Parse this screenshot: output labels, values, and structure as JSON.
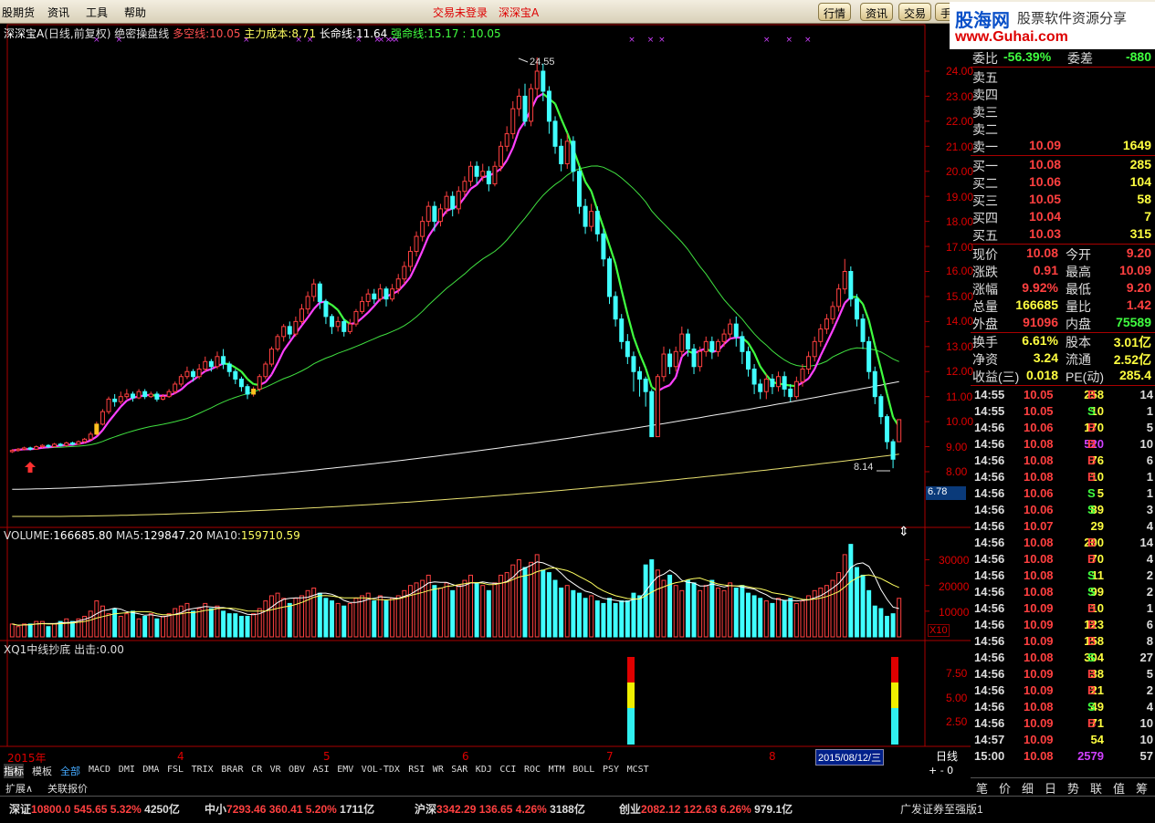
{
  "menu": [
    "股期货",
    "资讯",
    "工具",
    "帮助"
  ],
  "title_center": [
    "交易未登录",
    "深深宝A"
  ],
  "toolbar_buttons": [
    "行情",
    "资讯",
    "交易",
    "手"
  ],
  "watermark": {
    "brand": "股海网",
    "tagline": "股票软件资源分享",
    "url": "www.Guhai.com"
  },
  "info_line": {
    "stock": "深深宝A",
    "mode": "(日线,前复权)",
    "indicator": "绝密操盘线",
    "duokong_label": "多空线:",
    "duokong_value": "10.05",
    "zhuli_label": "主力成本:",
    "zhuli_value": "8.71",
    "changming_label": "长命线:",
    "changming_value": "11.64",
    "qiangming_label": "强命线:",
    "qiangming_value": "15.17",
    "extra_value": ": 10.05"
  },
  "price_axis": [
    "24.00",
    "23.00",
    "22.00",
    "21.00",
    "20.00",
    "19.00",
    "18.00",
    "17.00",
    "16.00",
    "15.00",
    "14.00",
    "13.00",
    "12.00",
    "11.00",
    "10.00",
    "9.00",
    "8.00"
  ],
  "price_axis_min": 8.0,
  "price_axis_max": 24.0,
  "current_price_tag": "6.78",
  "annotations": {
    "high": "24.55",
    "low": "8.14"
  },
  "volume_line": {
    "label": "VOLUME:",
    "value": "166685.80",
    "ma5_label": "MA5:",
    "ma5": "129847.20",
    "ma10_label": "MA10:",
    "ma10": "159710.59"
  },
  "volume_axis": [
    "30000",
    "20000",
    "10000"
  ],
  "volume_unit": "X10",
  "xq_line": {
    "label": "XQ1中线抄底",
    "out_label": "出击:",
    "out_value": "0.00"
  },
  "xq_axis": [
    "7.50",
    "5.00",
    "2.50"
  ],
  "date_axis": [
    "2015年",
    "4",
    "5",
    "6",
    "7",
    "8"
  ],
  "date_cursor": "2015/08/12/三",
  "period_label": "日线",
  "indicator_tabs": [
    "指标",
    "模板",
    "全部",
    "MACD",
    "DMI",
    "DMA",
    "FSL",
    "TRIX",
    "BRAR",
    "CR",
    "VR",
    "OBV",
    "ASI",
    "EMV",
    "VOL-TDX",
    "RSI",
    "WR",
    "SAR",
    "KDJ",
    "CCI",
    "ROC",
    "MTM",
    "BOLL",
    "PSY",
    "MCST"
  ],
  "sub_tabs": [
    "扩展∧",
    "关联报价"
  ],
  "order_book": {
    "ratio_label": "委比",
    "ratio_value": "-56.39%",
    "diff_label": "委差",
    "diff_value": "-880",
    "sells": [
      {
        "label": "卖五",
        "price": "",
        "vol": ""
      },
      {
        "label": "卖四",
        "price": "",
        "vol": ""
      },
      {
        "label": "卖三",
        "price": "",
        "vol": ""
      },
      {
        "label": "卖二",
        "price": "",
        "vol": ""
      },
      {
        "label": "卖一",
        "price": "10.09",
        "vol": "1649"
      }
    ],
    "buys": [
      {
        "label": "买一",
        "price": "10.08",
        "vol": "285"
      },
      {
        "label": "买二",
        "price": "10.06",
        "vol": "104"
      },
      {
        "label": "买三",
        "price": "10.05",
        "vol": "58"
      },
      {
        "label": "买四",
        "price": "10.04",
        "vol": "7"
      },
      {
        "label": "买五",
        "price": "10.03",
        "vol": "315"
      }
    ]
  },
  "quote_stats": [
    {
      "l1": "现价",
      "v1": "10.08",
      "l2": "今开",
      "v2": "9.20",
      "c1": "#ff4040",
      "c2": "#ff4040"
    },
    {
      "l1": "涨跌",
      "v1": "0.91",
      "l2": "最高",
      "v2": "10.09",
      "c1": "#ff4040",
      "c2": "#ff4040"
    },
    {
      "l1": "涨幅",
      "v1": "9.92%",
      "l2": "最低",
      "v2": "9.20",
      "c1": "#ff4040",
      "c2": "#ff4040"
    },
    {
      "l1": "总量",
      "v1": "166685",
      "l2": "量比",
      "v2": "1.42",
      "c1": "#ffff40",
      "c2": "#ff4040"
    },
    {
      "l1": "外盘",
      "v1": "91096",
      "l2": "内盘",
      "v2": "75589",
      "c1": "#ff4040",
      "c2": "#40ff40"
    },
    {
      "l1": "换手",
      "v1": "6.61%",
      "l2": "股本",
      "v2": "3.01亿",
      "c1": "#ffff40",
      "c2": "#ffff40"
    },
    {
      "l1": "净资",
      "v1": "3.24",
      "l2": "流通",
      "v2": "2.52亿",
      "c1": "#ffff40",
      "c2": "#ffff40"
    },
    {
      "l1": "收益(三)",
      "v1": "0.018",
      "l2": "PE(动)",
      "v2": "285.4",
      "c1": "#ffff40",
      "c2": "#ffff40"
    }
  ],
  "ticks": [
    {
      "t": "14:55",
      "p": "10.05",
      "v": "258",
      "d": "B",
      "n": "14",
      "vc": "#ffff40"
    },
    {
      "t": "14:55",
      "p": "10.05",
      "v": "10",
      "d": "S",
      "n": "1",
      "vc": "#ffff40"
    },
    {
      "t": "14:56",
      "p": "10.06",
      "v": "170",
      "d": "B",
      "n": "5",
      "vc": "#ffff40"
    },
    {
      "t": "14:56",
      "p": "10.08",
      "v": "520",
      "d": "B",
      "n": "10",
      "vc": "#d040ff"
    },
    {
      "t": "14:56",
      "p": "10.08",
      "v": "76",
      "d": "B",
      "n": "6",
      "vc": "#ffff40"
    },
    {
      "t": "14:56",
      "p": "10.08",
      "v": "10",
      "d": "B",
      "n": "1",
      "vc": "#ffff40"
    },
    {
      "t": "14:56",
      "p": "10.06",
      "v": "5",
      "d": "S",
      "n": "1",
      "vc": "#ffff40"
    },
    {
      "t": "14:56",
      "p": "10.06",
      "v": "89",
      "d": "S",
      "n": "3",
      "vc": "#ffff40"
    },
    {
      "t": "14:56",
      "p": "10.07",
      "v": "29",
      "d": "",
      "n": "4",
      "vc": "#ffff40"
    },
    {
      "t": "14:56",
      "p": "10.08",
      "v": "200",
      "d": "B",
      "n": "14",
      "vc": "#ffff40"
    },
    {
      "t": "14:56",
      "p": "10.08",
      "v": "70",
      "d": "B",
      "n": "4",
      "vc": "#ffff40"
    },
    {
      "t": "14:56",
      "p": "10.08",
      "v": "11",
      "d": "S",
      "n": "2",
      "vc": "#ffff40"
    },
    {
      "t": "14:56",
      "p": "10.08",
      "v": "99",
      "d": "S",
      "n": "2",
      "vc": "#ffff40"
    },
    {
      "t": "14:56",
      "p": "10.09",
      "v": "10",
      "d": "B",
      "n": "1",
      "vc": "#ffff40"
    },
    {
      "t": "14:56",
      "p": "10.09",
      "v": "123",
      "d": "B",
      "n": "6",
      "vc": "#ffff40"
    },
    {
      "t": "14:56",
      "p": "10.09",
      "v": "158",
      "d": "B",
      "n": "8",
      "vc": "#ffff40"
    },
    {
      "t": "14:56",
      "p": "10.08",
      "v": "304",
      "d": "S",
      "n": "27",
      "vc": "#ffff40"
    },
    {
      "t": "14:56",
      "p": "10.09",
      "v": "38",
      "d": "B",
      "n": "5",
      "vc": "#ffff40"
    },
    {
      "t": "14:56",
      "p": "10.09",
      "v": "21",
      "d": "B",
      "n": "2",
      "vc": "#ffff40"
    },
    {
      "t": "14:56",
      "p": "10.08",
      "v": "49",
      "d": "S",
      "n": "4",
      "vc": "#ffff40"
    },
    {
      "t": "14:56",
      "p": "10.09",
      "v": "71",
      "d": "B",
      "n": "10",
      "vc": "#ffff40"
    },
    {
      "t": "14:57",
      "p": "10.09",
      "v": "54",
      "d": "",
      "n": "10",
      "vc": "#ffff40"
    },
    {
      "t": "15:00",
      "p": "10.08",
      "v": "2579",
      "d": "",
      "n": "57",
      "vc": "#d040ff"
    }
  ],
  "panel_tabs": [
    "笔",
    "价",
    "细",
    "日",
    "势",
    "联",
    "值",
    "筹"
  ],
  "status_bar": [
    {
      "name": "深证",
      "val": "10800.0",
      "chg": "545.65",
      "pct": "5.32%",
      "amt": "4250亿"
    },
    {
      "name": "中小",
      "val": "7293.46",
      "chg": "360.41",
      "pct": "5.20%",
      "amt": "1711亿"
    },
    {
      "name": "沪深",
      "val": "3342.29",
      "chg": "136.65",
      "pct": "4.26%",
      "amt": "3188亿"
    },
    {
      "name": "创业",
      "val": "2082.12",
      "chg": "122.63",
      "pct": "6.26%",
      "amt": "979.1亿"
    }
  ],
  "status_broker": "广发证券至强版1",
  "chart_data": {
    "type": "candlestick",
    "candles": [
      [
        8.8,
        8.85,
        8.9,
        8.75
      ],
      [
        8.85,
        8.9,
        8.95,
        8.8
      ],
      [
        8.9,
        8.95,
        9.0,
        8.85
      ],
      [
        8.95,
        8.9,
        9.0,
        8.85
      ],
      [
        8.9,
        9.0,
        9.05,
        8.88
      ],
      [
        9.0,
        9.05,
        9.1,
        8.95
      ],
      [
        9.05,
        9.0,
        9.1,
        8.95
      ],
      [
        9.0,
        9.1,
        9.15,
        8.98
      ],
      [
        9.1,
        9.05,
        9.15,
        9.0
      ],
      [
        9.05,
        9.15,
        9.2,
        9.0
      ],
      [
        9.15,
        9.1,
        9.2,
        9.05
      ],
      [
        9.1,
        9.2,
        9.25,
        9.08
      ],
      [
        9.2,
        9.3,
        9.35,
        9.15
      ],
      [
        9.3,
        9.5,
        9.6,
        9.25
      ],
      [
        9.5,
        9.9,
        10.0,
        9.45
      ],
      [
        9.9,
        10.4,
        10.5,
        9.85
      ],
      [
        10.4,
        10.9,
        11.0,
        10.3
      ],
      [
        10.9,
        10.8,
        11.1,
        10.6
      ],
      [
        10.8,
        11.0,
        11.2,
        10.7
      ],
      [
        11.0,
        11.1,
        11.3,
        10.9
      ],
      [
        11.1,
        10.95,
        11.2,
        10.8
      ],
      [
        10.95,
        11.2,
        11.3,
        10.9
      ],
      [
        11.2,
        11.0,
        11.3,
        10.9
      ],
      [
        11.0,
        11.1,
        11.2,
        10.95
      ],
      [
        11.1,
        10.9,
        11.2,
        10.8
      ],
      [
        10.9,
        11.0,
        11.1,
        10.85
      ],
      [
        11.0,
        11.2,
        11.3,
        10.95
      ],
      [
        11.2,
        11.5,
        11.6,
        11.1
      ],
      [
        11.5,
        11.8,
        11.9,
        11.4
      ],
      [
        11.8,
        12.0,
        12.2,
        11.7
      ],
      [
        12.0,
        11.8,
        12.1,
        11.6
      ],
      [
        11.8,
        12.1,
        12.3,
        11.7
      ],
      [
        12.1,
        12.4,
        12.6,
        12.0
      ],
      [
        12.4,
        12.2,
        12.5,
        12.0
      ],
      [
        12.2,
        12.6,
        12.8,
        12.1
      ],
      [
        12.6,
        12.3,
        12.9,
        12.1
      ],
      [
        12.3,
        12.0,
        12.4,
        11.8
      ],
      [
        12.0,
        11.7,
        12.1,
        11.5
      ],
      [
        11.7,
        11.4,
        11.8,
        11.2
      ],
      [
        11.4,
        11.1,
        11.5,
        10.9
      ],
      [
        11.1,
        11.3,
        11.4,
        11.0
      ],
      [
        11.3,
        11.8,
        11.9,
        11.2
      ],
      [
        11.8,
        12.3,
        12.4,
        11.7
      ],
      [
        12.3,
        12.9,
        13.0,
        12.2
      ],
      [
        12.9,
        13.4,
        13.5,
        12.8
      ],
      [
        13.4,
        13.8,
        13.9,
        13.2
      ],
      [
        13.8,
        13.5,
        14.0,
        13.3
      ],
      [
        13.5,
        14.0,
        14.2,
        13.4
      ],
      [
        14.0,
        14.5,
        14.7,
        13.9
      ],
      [
        14.5,
        15.0,
        15.2,
        14.3
      ],
      [
        15.0,
        15.5,
        15.7,
        14.8
      ],
      [
        15.5,
        14.8,
        15.6,
        14.5
      ],
      [
        14.8,
        14.2,
        14.9,
        13.9
      ],
      [
        14.2,
        13.8,
        14.3,
        13.5
      ],
      [
        13.8,
        14.0,
        14.2,
        13.6
      ],
      [
        14.0,
        13.6,
        14.1,
        13.4
      ],
      [
        13.6,
        13.9,
        14.1,
        13.5
      ],
      [
        13.9,
        14.4,
        14.5,
        13.8
      ],
      [
        14.4,
        14.8,
        15.0,
        14.3
      ],
      [
        14.8,
        15.1,
        15.3,
        14.6
      ],
      [
        15.1,
        14.9,
        15.3,
        14.7
      ],
      [
        14.9,
        15.3,
        15.5,
        14.8
      ],
      [
        15.3,
        14.9,
        15.4,
        14.6
      ],
      [
        14.9,
        15.3,
        15.5,
        14.8
      ],
      [
        15.3,
        15.7,
        15.9,
        15.1
      ],
      [
        15.7,
        16.2,
        16.4,
        15.5
      ],
      [
        16.2,
        16.8,
        17.0,
        16.0
      ],
      [
        16.8,
        17.4,
        17.6,
        16.6
      ],
      [
        17.4,
        18.0,
        18.2,
        17.2
      ],
      [
        18.0,
        18.6,
        18.8,
        17.8
      ],
      [
        18.6,
        18.0,
        18.8,
        17.6
      ],
      [
        18.0,
        18.5,
        18.7,
        17.8
      ],
      [
        18.5,
        19.0,
        19.2,
        18.3
      ],
      [
        19.0,
        18.5,
        19.2,
        18.2
      ],
      [
        18.5,
        19.2,
        19.4,
        18.3
      ],
      [
        19.2,
        19.6,
        19.8,
        19.0
      ],
      [
        19.6,
        20.2,
        20.4,
        19.4
      ],
      [
        20.2,
        19.8,
        20.4,
        19.5
      ],
      [
        19.8,
        20.0,
        20.3,
        19.6
      ],
      [
        20.0,
        19.5,
        20.2,
        19.2
      ],
      [
        19.5,
        20.2,
        20.4,
        19.4
      ],
      [
        20.2,
        21.0,
        21.2,
        20.0
      ],
      [
        21.0,
        21.5,
        21.8,
        20.8
      ],
      [
        21.5,
        22.5,
        22.8,
        21.3
      ],
      [
        22.5,
        23.0,
        23.3,
        22.2
      ],
      [
        23.0,
        22.0,
        23.5,
        21.8
      ],
      [
        22.0,
        23.3,
        23.5,
        21.8
      ],
      [
        23.3,
        24.0,
        24.55,
        23.0
      ],
      [
        24.0,
        23.2,
        24.3,
        22.8
      ],
      [
        23.2,
        22.0,
        23.4,
        21.5
      ],
      [
        22.0,
        21.0,
        22.2,
        20.7
      ],
      [
        21.0,
        20.3,
        21.3,
        20.0
      ],
      [
        20.3,
        21.2,
        21.5,
        20.1
      ],
      [
        21.2,
        20.0,
        21.4,
        19.6
      ],
      [
        20.0,
        18.6,
        20.2,
        18.3
      ],
      [
        18.6,
        17.8,
        18.9,
        17.5
      ],
      [
        17.8,
        18.4,
        18.7,
        17.6
      ],
      [
        18.4,
        17.5,
        18.6,
        17.2
      ],
      [
        17.5,
        16.5,
        17.7,
        16.2
      ],
      [
        16.5,
        15.0,
        16.6,
        14.7
      ],
      [
        15.0,
        14.1,
        15.2,
        13.8
      ],
      [
        14.1,
        13.2,
        14.3,
        12.9
      ],
      [
        13.2,
        12.6,
        13.5,
        12.3
      ],
      [
        12.6,
        12.0,
        12.8,
        11.2
      ],
      [
        12.0,
        11.7,
        12.2,
        11.0
      ],
      [
        11.7,
        11.2,
        11.8,
        10.6
      ],
      [
        11.2,
        9.4,
        11.3,
        9.4
      ],
      [
        9.4,
        11.8,
        11.9,
        9.4
      ],
      [
        11.8,
        12.7,
        13.0,
        11.6
      ],
      [
        12.7,
        12.2,
        12.9,
        11.9
      ],
      [
        12.2,
        12.8,
        13.0,
        12.0
      ],
      [
        12.8,
        13.5,
        13.8,
        12.6
      ],
      [
        13.5,
        12.9,
        13.7,
        12.6
      ],
      [
        12.9,
        12.2,
        13.1,
        11.9
      ],
      [
        12.2,
        12.8,
        13.0,
        12.0
      ],
      [
        12.8,
        13.2,
        13.4,
        12.6
      ],
      [
        13.2,
        12.8,
        13.4,
        12.5
      ],
      [
        12.8,
        13.2,
        13.3,
        12.6
      ],
      [
        13.2,
        13.5,
        13.7,
        13.0
      ],
      [
        13.5,
        13.9,
        14.1,
        13.3
      ],
      [
        13.9,
        13.4,
        14.2,
        13.0
      ],
      [
        13.4,
        12.8,
        13.6,
        12.3
      ],
      [
        12.8,
        12.1,
        13.0,
        11.8
      ],
      [
        12.1,
        11.5,
        12.3,
        11.1
      ],
      [
        11.5,
        11.2,
        11.7,
        10.9
      ],
      [
        11.2,
        11.7,
        11.9,
        10.9
      ],
      [
        11.7,
        11.4,
        11.9,
        11.1
      ],
      [
        11.4,
        11.8,
        12.0,
        11.2
      ],
      [
        11.8,
        11.3,
        12.0,
        11.0
      ],
      [
        11.3,
        11.0,
        11.5,
        10.8
      ],
      [
        11.0,
        11.6,
        11.8,
        10.9
      ],
      [
        11.6,
        12.1,
        12.3,
        11.4
      ],
      [
        12.1,
        12.6,
        12.8,
        11.9
      ],
      [
        12.6,
        13.2,
        13.4,
        12.4
      ],
      [
        13.2,
        13.7,
        13.9,
        13.0
      ],
      [
        13.7,
        14.1,
        14.3,
        13.5
      ],
      [
        14.1,
        14.6,
        14.8,
        13.9
      ],
      [
        14.6,
        15.3,
        15.5,
        14.4
      ],
      [
        15.3,
        16.0,
        16.5,
        15.1
      ],
      [
        16.0,
        14.9,
        16.2,
        14.6
      ],
      [
        14.9,
        14.1,
        15.1,
        13.8
      ],
      [
        14.1,
        13.2,
        14.3,
        12.9
      ],
      [
        13.2,
        12.0,
        13.4,
        11.7
      ],
      [
        12.0,
        11.0,
        12.2,
        10.7
      ],
      [
        11.0,
        10.2,
        11.1,
        9.9
      ],
      [
        10.2,
        9.2,
        10.3,
        8.9
      ],
      [
        9.2,
        8.5,
        9.3,
        8.14
      ],
      [
        9.2,
        10.08,
        10.09,
        9.2
      ]
    ],
    "volumes": [
      5,
      4,
      5,
      5,
      6,
      6,
      4,
      5,
      6,
      7,
      6,
      7,
      8,
      10,
      14,
      12,
      9,
      11,
      8,
      9,
      10,
      7,
      8,
      9,
      7,
      8,
      9,
      11,
      12,
      13,
      10,
      11,
      13,
      11,
      12,
      10,
      9,
      9,
      8,
      8,
      9,
      11,
      14,
      16,
      17,
      15,
      13,
      15,
      16,
      18,
      19,
      17,
      15,
      14,
      13,
      12,
      13,
      15,
      16,
      17,
      14,
      16,
      14,
      15,
      16,
      18,
      20,
      21,
      22,
      24,
      20,
      19,
      21,
      18,
      20,
      22,
      24,
      21,
      20,
      18,
      21,
      24,
      25,
      28,
      30,
      27,
      29,
      32,
      26,
      25,
      22,
      19,
      20,
      18,
      17,
      15,
      16,
      14,
      13,
      15,
      13,
      14,
      14,
      17,
      16,
      28,
      30,
      26,
      22,
      24,
      20,
      18,
      22,
      21,
      18,
      20,
      22,
      19,
      18,
      21,
      19,
      20,
      17,
      16,
      15,
      14,
      13,
      15,
      14,
      15,
      13,
      14,
      16,
      18,
      19,
      20,
      22,
      25,
      32,
      36,
      27,
      24,
      18,
      12,
      11,
      8,
      9,
      15
    ],
    "limit_up_markers": [
      14,
      40
    ]
  }
}
